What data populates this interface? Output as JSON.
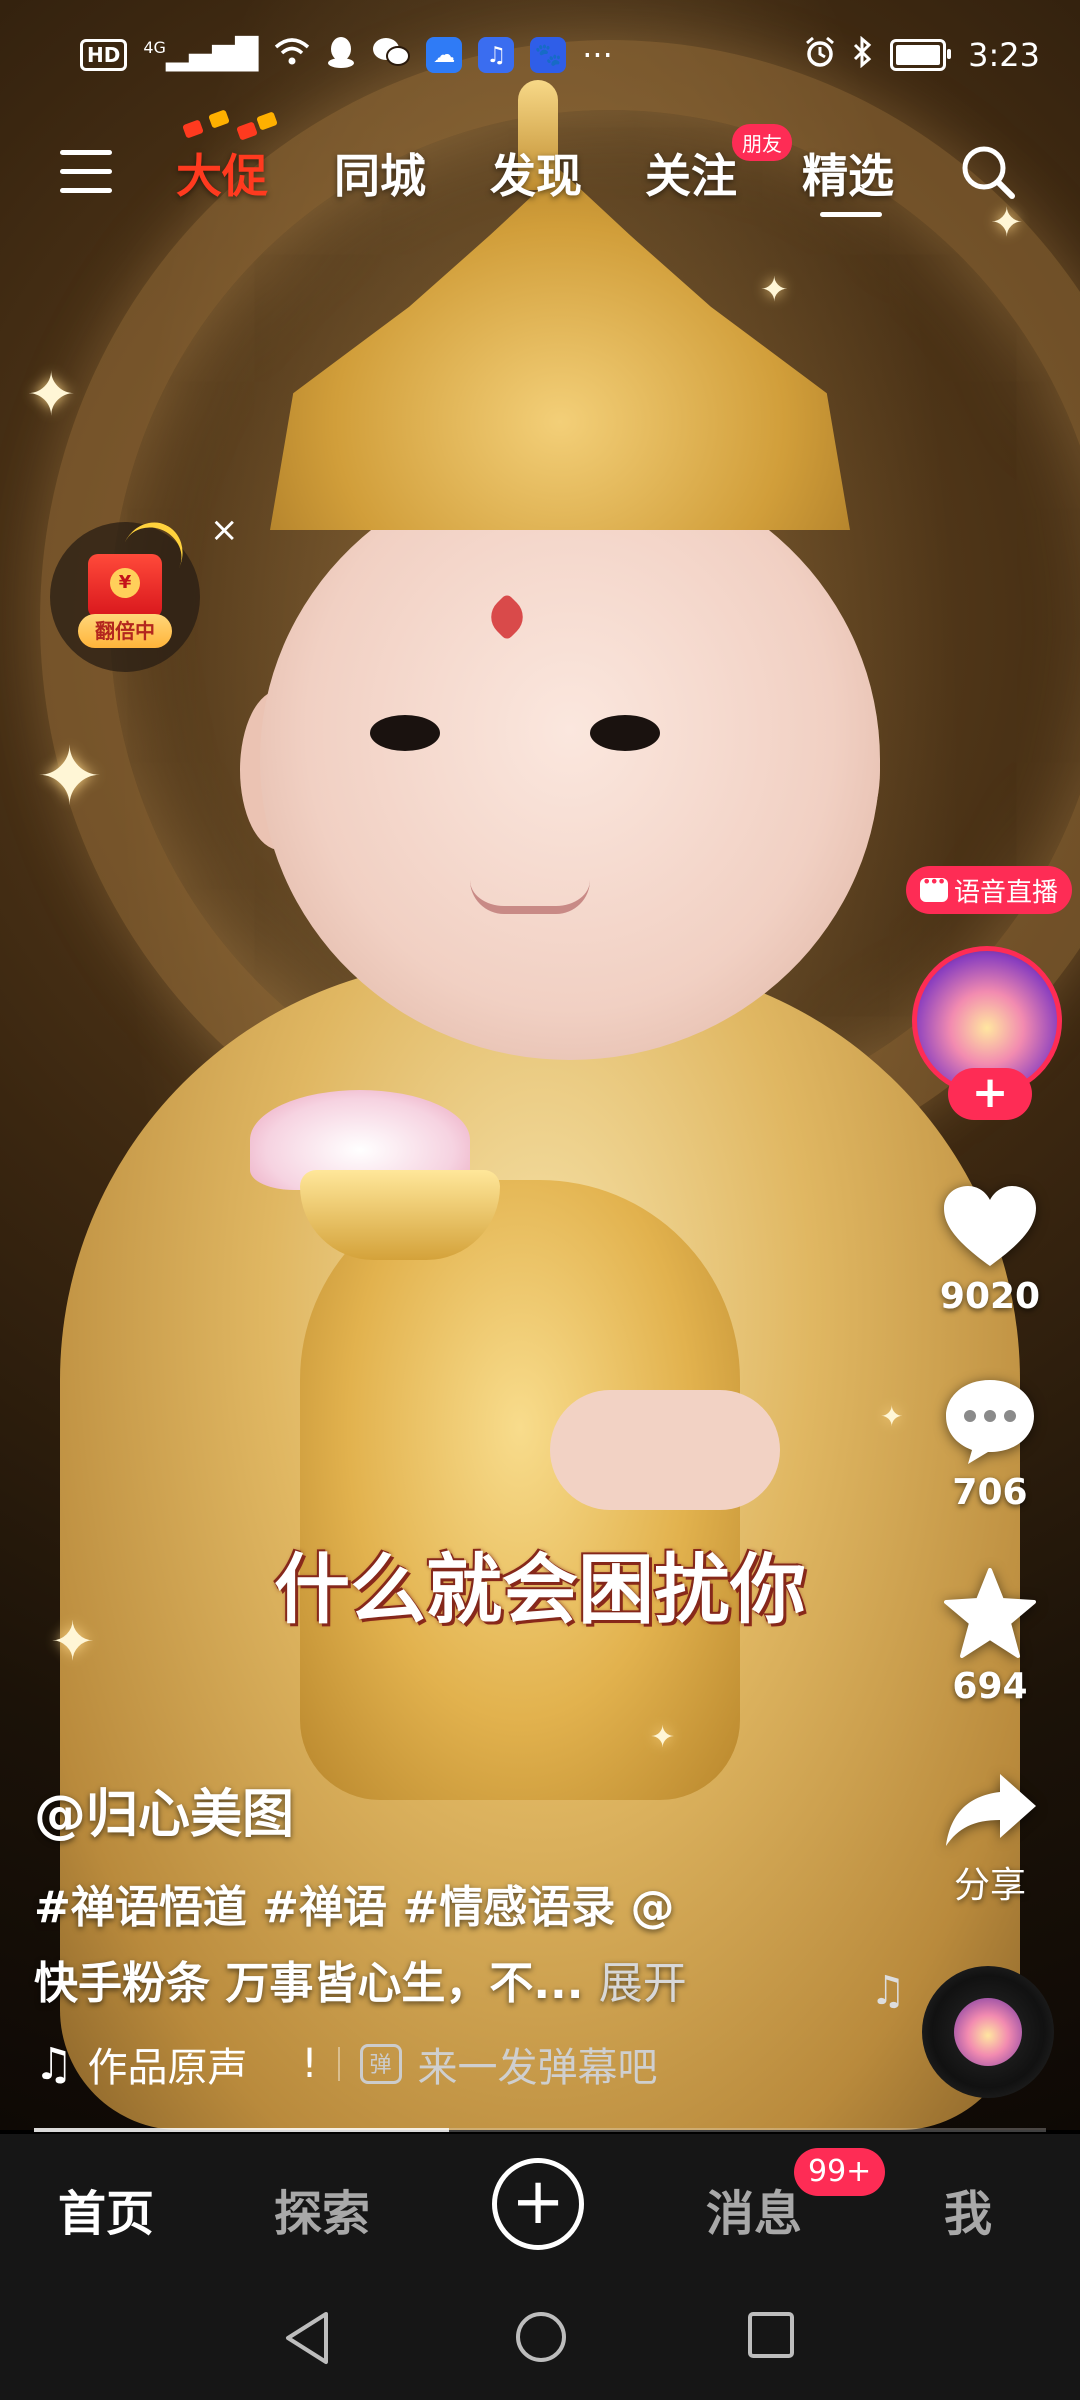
{
  "status_bar": {
    "time": "3:23",
    "hd_label": "HD",
    "network": "4G",
    "more": "···"
  },
  "top_nav": {
    "tabs": [
      {
        "label": "大促",
        "style": "promo"
      },
      {
        "label": "同城"
      },
      {
        "label": "发现"
      },
      {
        "label": "关注"
      },
      {
        "label": "精选",
        "active": true
      }
    ],
    "friend_badge": "朋友"
  },
  "red_packet": {
    "coin_symbol": "¥",
    "label": "翻倍中",
    "close": "×"
  },
  "side_actions": {
    "live_badge": "语音直播",
    "follow": "+",
    "like_count": "9020",
    "comment_count": "706",
    "favorite_count": "694",
    "share_label": "分享"
  },
  "video": {
    "subtitle": "什么就会困扰你",
    "author": "@归心美图",
    "description_line1": "#禅语悟道 #禅语 #情感语录 @",
    "description_line2": "快手粉条 万事皆心生，不...",
    "expand_label": "展开",
    "sound_label": "作品原声",
    "warn_mark": "!",
    "danmu_icon_text": "弹",
    "danmu_placeholder": "来一发弹幕吧",
    "progress": 0.41
  },
  "tab_bar": {
    "home": "首页",
    "explore": "探索",
    "create": "+",
    "messages": "消息",
    "messages_badge": "99+",
    "me": "我"
  },
  "colors": {
    "accent": "#fe2c55",
    "promo": "#ff3a1f",
    "tabbar_bg": "#161616"
  }
}
